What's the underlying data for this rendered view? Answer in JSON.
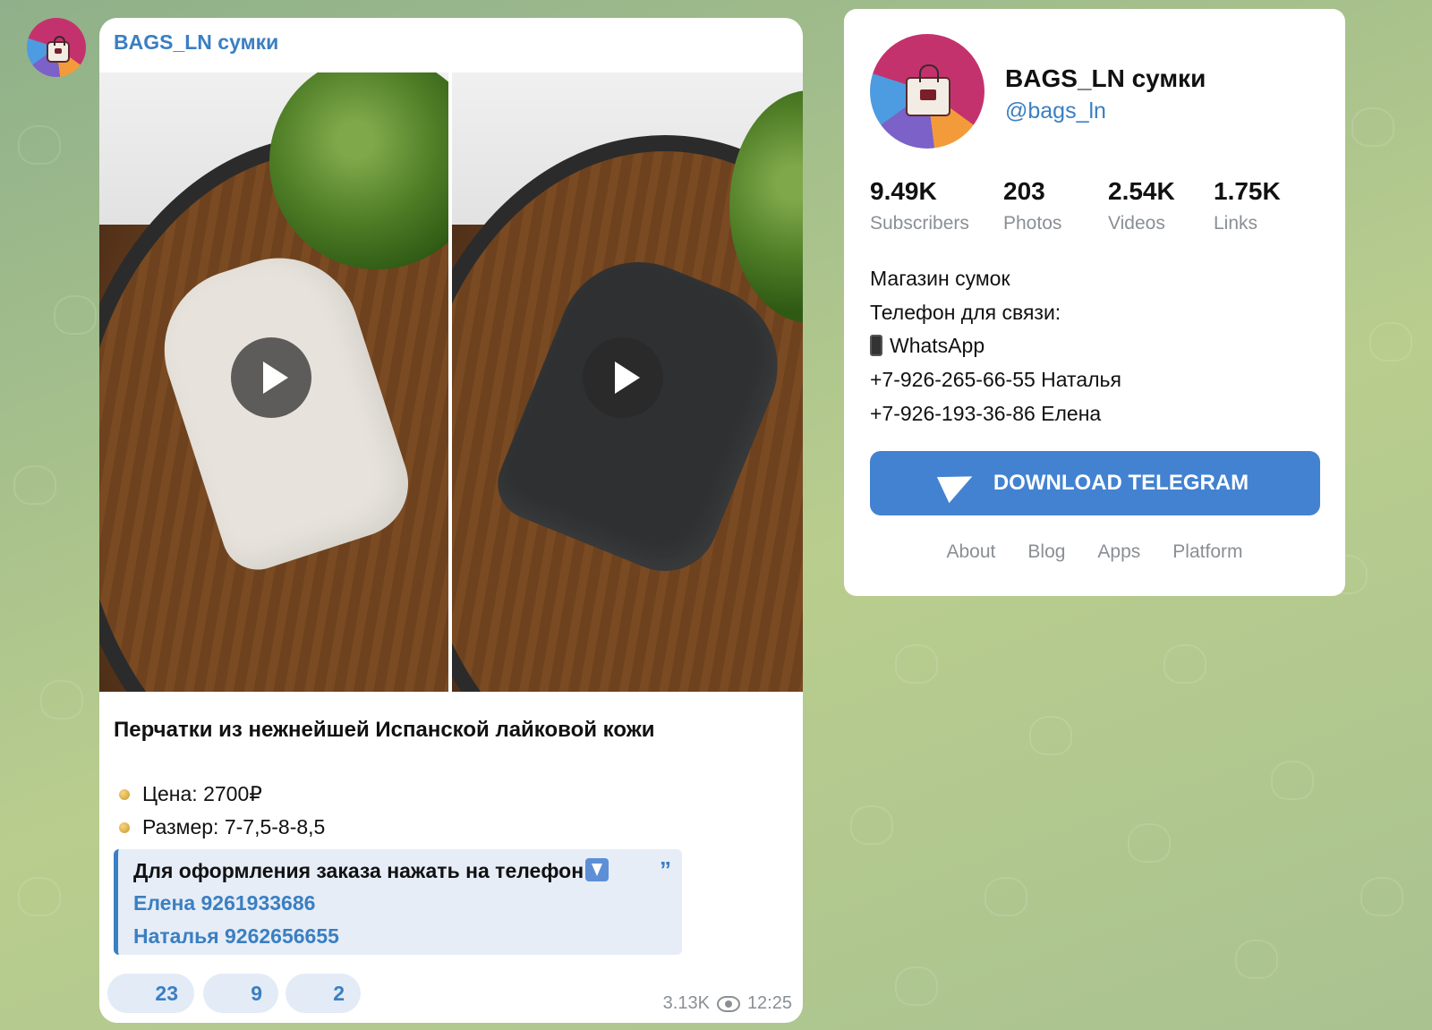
{
  "post": {
    "channel_name": "BAGS_LN сумки",
    "title": "Перчатки из нежнейшей Испанской лайковой кожи",
    "bullets": [
      "Цена: 2700₽",
      "Размер: 7-7,5-8-8,5"
    ],
    "quote": {
      "heading": "Для оформления заказа нажать на телефон",
      "links": [
        "Елена 9261933686",
        "Наталья 9262656655"
      ],
      "mark": "”"
    },
    "reactions": [
      "23",
      "9",
      "2"
    ],
    "views": "3.13K",
    "time": "12:25",
    "icons": {
      "play": "play-icon",
      "views": "eye-icon",
      "arrow": "down-arrow-icon"
    }
  },
  "profile": {
    "title": "BAGS_LN сумки",
    "username": "@bags_ln",
    "stats": [
      {
        "value": "9.49K",
        "label": "Subscribers"
      },
      {
        "value": "203",
        "label": "Photos"
      },
      {
        "value": "2.54K",
        "label": "Videos"
      },
      {
        "value": "1.75K",
        "label": "Links"
      }
    ],
    "description": [
      "Магазин сумок",
      "Телефон для связи:",
      "WhatsApp",
      "+7-926-265-66-55 Наталья",
      "+7-926-193-36-86 Елена"
    ],
    "download_label": "DOWNLOAD TELEGRAM",
    "footer_links": [
      "About",
      "Blog",
      "Apps",
      "Platform"
    ]
  },
  "colors": {
    "accent": "#3a7fc2",
    "button": "#4382d1",
    "background_top": "#8fb08a",
    "background_bottom": "#b9cd8e"
  }
}
